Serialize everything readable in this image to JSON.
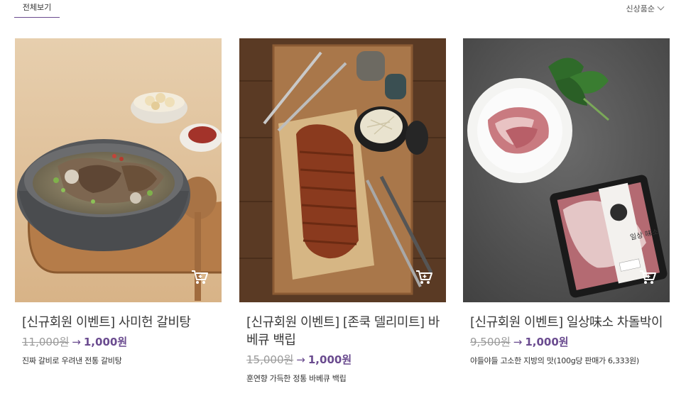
{
  "tabs": {
    "all_label": "전체보기"
  },
  "sort": {
    "label": "신상품순",
    "icon": "chevron-down-icon"
  },
  "products": [
    {
      "title": "[신규회원 이벤트] 사미헌 갈비탕",
      "original_price": "11,000원",
      "arrow": "→",
      "sale_price": "1,000원",
      "description": "진짜 갈비로 우려낸 전통 갈비탕"
    },
    {
      "title": "[신규회원 이벤트] [존쿡 델리미트] 바베큐 백립",
      "original_price": "15,000원",
      "arrow": "→",
      "sale_price": "1,000원",
      "description": "훈연향 가득한 정통 바베큐 백립"
    },
    {
      "title": "[신규회원 이벤트] 일상味소 차돌박이",
      "original_price": "9,500원",
      "arrow": "→",
      "sale_price": "1,000원",
      "description": "야들야들 고소한 지방의 맛(100g당 판매가 6,333원)",
      "package_brand": "일상\n味소"
    }
  ],
  "colors": {
    "accent": "#6a4b8f"
  }
}
